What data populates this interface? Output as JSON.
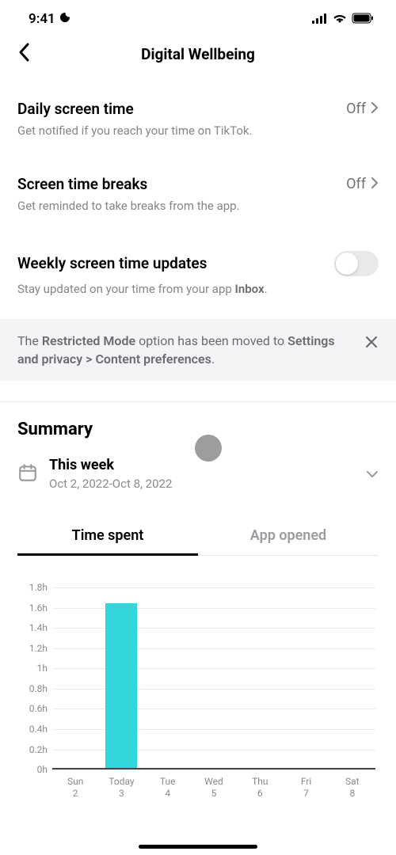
{
  "status": {
    "time": "9:41"
  },
  "header": {
    "title": "Digital Wellbeing"
  },
  "rows": {
    "daily": {
      "title": "Daily screen time",
      "value": "Off",
      "sub": "Get notified if you reach your time on TikTok."
    },
    "breaks": {
      "title": "Screen time breaks",
      "value": "Off",
      "sub": "Get reminded to take breaks from the app."
    },
    "weekly": {
      "title": "Weekly screen time updates",
      "sub_pre": "Stay updated on your time from your app ",
      "sub_bold": "Inbox",
      "sub_post": "."
    }
  },
  "notice": {
    "pre": "The ",
    "b1": "Restricted Mode",
    "mid": " option has been moved to ",
    "b2": "Settings and privacy > Content preferences",
    "post": "."
  },
  "summary": {
    "heading": "Summary",
    "week_title": "This week",
    "week_range": "Oct 2, 2022-Oct 8, 2022"
  },
  "tabs": {
    "time": "Time spent",
    "opened": "App opened"
  },
  "chart_data": {
    "type": "bar",
    "title": "",
    "xlabel": "",
    "ylabel": "",
    "ylim": [
      0,
      1.8
    ],
    "y_ticks": [
      "0h",
      "0.2h",
      "0.4h",
      "0.6h",
      "0.8h",
      "1h",
      "1.2h",
      "1.4h",
      "1.6h",
      "1.8h"
    ],
    "categories": [
      {
        "d": "Sun",
        "n": "2"
      },
      {
        "d": "Today",
        "n": "3"
      },
      {
        "d": "Tue",
        "n": "4"
      },
      {
        "d": "Wed",
        "n": "5"
      },
      {
        "d": "Thu",
        "n": "6"
      },
      {
        "d": "Fri",
        "n": "7"
      },
      {
        "d": "Sat",
        "n": "8"
      }
    ],
    "values": [
      0,
      1.63,
      0,
      0,
      0,
      0,
      0
    ]
  }
}
